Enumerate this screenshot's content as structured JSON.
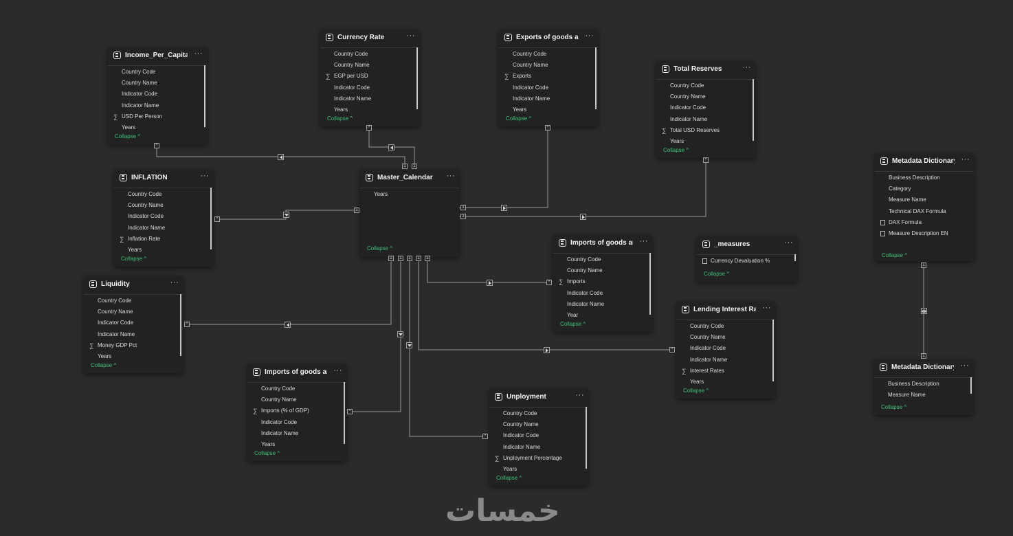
{
  "collapse_label": "Collapse",
  "more_glyph": "···",
  "one": "1",
  "many": "*",
  "tables": [
    {
      "id": "income",
      "title": "Income_Per_Capita (USD)",
      "fields": [
        {
          "label": "Country Code",
          "type": "text"
        },
        {
          "label": "Country Name",
          "type": "text"
        },
        {
          "label": "Indicator Code",
          "type": "text"
        },
        {
          "label": "Indicator Name",
          "type": "text"
        },
        {
          "label": "USD Per Person",
          "type": "sum"
        },
        {
          "label": "Years",
          "type": "text"
        }
      ]
    },
    {
      "id": "currency",
      "title": "Currency Rate",
      "fields": [
        {
          "label": "Country Code",
          "type": "text"
        },
        {
          "label": "Country Name",
          "type": "text"
        },
        {
          "label": "EGP per USD",
          "type": "sum"
        },
        {
          "label": "Indicator Code",
          "type": "text"
        },
        {
          "label": "Indicator Name",
          "type": "text"
        },
        {
          "label": "Years",
          "type": "text"
        }
      ]
    },
    {
      "id": "exports",
      "title": "Exports of goods and s...",
      "fields": [
        {
          "label": "Country Code",
          "type": "text"
        },
        {
          "label": "Country Name",
          "type": "text"
        },
        {
          "label": "Exports",
          "type": "sum"
        },
        {
          "label": "Indicator Code",
          "type": "text"
        },
        {
          "label": "Indicator Name",
          "type": "text"
        },
        {
          "label": "Years",
          "type": "text"
        }
      ]
    },
    {
      "id": "reserves",
      "title": "Total Reserves",
      "fields": [
        {
          "label": "Country Code",
          "type": "text"
        },
        {
          "label": "Country Name",
          "type": "text"
        },
        {
          "label": "Indicator Code",
          "type": "text"
        },
        {
          "label": "Indicator Name",
          "type": "text"
        },
        {
          "label": "Total USD Reserves",
          "type": "sum"
        },
        {
          "label": "Years",
          "type": "text"
        }
      ]
    },
    {
      "id": "inflation",
      "title": "INFLATION",
      "fields": [
        {
          "label": "Country Code",
          "type": "text"
        },
        {
          "label": "Country Name",
          "type": "text"
        },
        {
          "label": "Indicator Code",
          "type": "text"
        },
        {
          "label": "Indicator Name",
          "type": "text"
        },
        {
          "label": "Inflation Rate",
          "type": "sum"
        },
        {
          "label": "Years",
          "type": "text"
        }
      ]
    },
    {
      "id": "calendar",
      "title": "Master_Calendar",
      "fields": [
        {
          "label": "Years",
          "type": "text"
        }
      ]
    },
    {
      "id": "metaen",
      "title": "Metadata Dictionary EN",
      "fields": [
        {
          "label": "Business Description",
          "type": "text"
        },
        {
          "label": "Category",
          "type": "text"
        },
        {
          "label": "Measure Name",
          "type": "text"
        },
        {
          "label": "Technical DAX Formula",
          "type": "text"
        },
        {
          "label": "DAX Formula",
          "type": "calc"
        },
        {
          "label": "Measure Description EN",
          "type": "calc"
        }
      ]
    },
    {
      "id": "imports1",
      "title": "Imports of goods and s...",
      "fields": [
        {
          "label": "Country Code",
          "type": "text"
        },
        {
          "label": "Country Name",
          "type": "text"
        },
        {
          "label": "Imports",
          "type": "sum"
        },
        {
          "label": "Indicator Code",
          "type": "text"
        },
        {
          "label": "Indicator Name",
          "type": "text"
        },
        {
          "label": "Year",
          "type": "text"
        }
      ]
    },
    {
      "id": "measures",
      "title": "_measures",
      "fields": [
        {
          "label": "Currency Devaluation %",
          "type": "calc"
        }
      ]
    },
    {
      "id": "liquidity",
      "title": "Liquidity",
      "fields": [
        {
          "label": "Country Code",
          "type": "text"
        },
        {
          "label": "Country Name",
          "type": "text"
        },
        {
          "label": "Indicator Code",
          "type": "text"
        },
        {
          "label": "Indicator Name",
          "type": "text"
        },
        {
          "label": "Money GDP Pct",
          "type": "sum"
        },
        {
          "label": "Years",
          "type": "text"
        }
      ]
    },
    {
      "id": "lending",
      "title": "Lending Interest Rate",
      "fields": [
        {
          "label": "Country Code",
          "type": "text"
        },
        {
          "label": "Country Name",
          "type": "text"
        },
        {
          "label": "Indicator Code",
          "type": "text"
        },
        {
          "label": "Indicator Name",
          "type": "text"
        },
        {
          "label": "Interest Rates",
          "type": "sum"
        },
        {
          "label": "Years",
          "type": "text"
        }
      ]
    },
    {
      "id": "imports2",
      "title": "Imports of goods and s...",
      "fields": [
        {
          "label": "Country Code",
          "type": "text"
        },
        {
          "label": "Country Name",
          "type": "text"
        },
        {
          "label": "Imports (% of GDP)",
          "type": "sum"
        },
        {
          "label": "Indicator Code",
          "type": "text"
        },
        {
          "label": "Indicator Name",
          "type": "text"
        },
        {
          "label": "Years",
          "type": "text"
        }
      ]
    },
    {
      "id": "unemployment",
      "title": "Unployment",
      "fields": [
        {
          "label": "Country Code",
          "type": "text"
        },
        {
          "label": "Country Name",
          "type": "text"
        },
        {
          "label": "Indicator Code",
          "type": "text"
        },
        {
          "label": "Indicator Name",
          "type": "text"
        },
        {
          "label": "Unployment Percentage",
          "type": "sum"
        },
        {
          "label": "Years",
          "type": "text"
        }
      ]
    },
    {
      "id": "metaar",
      "title": "Metadata Dictionary AR",
      "fields": [
        {
          "label": "Business Description",
          "type": "text"
        },
        {
          "label": "Measure Name",
          "type": "text"
        }
      ]
    }
  ],
  "watermark": "خمسات"
}
